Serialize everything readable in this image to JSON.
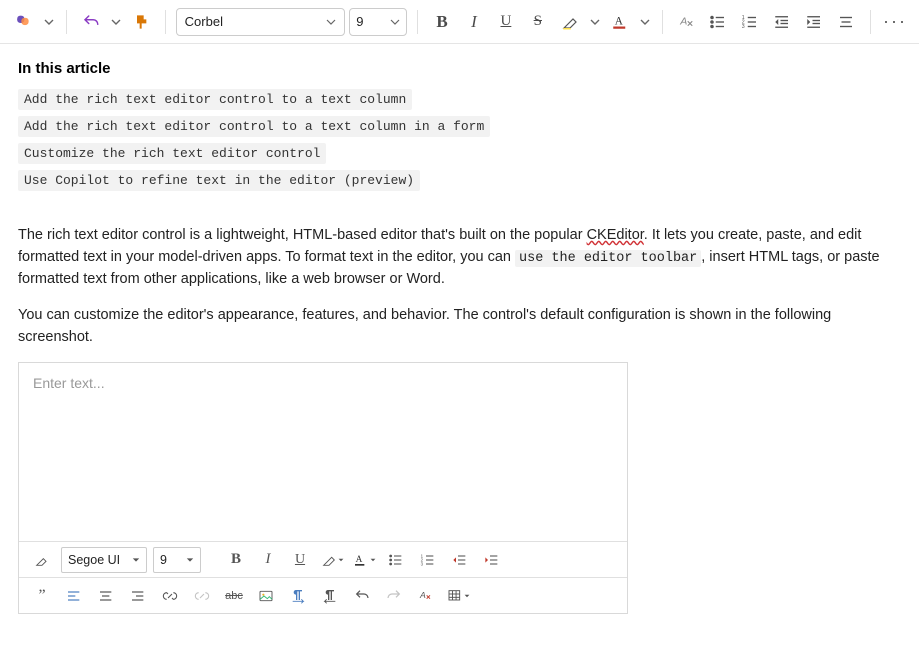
{
  "toolbar": {
    "font": "Corbel",
    "size": "9"
  },
  "article": {
    "header": "In this article",
    "toc": [
      "Add the rich text editor control to a text column",
      "Add the rich text editor control to a text column in a form",
      "Customize the rich text editor control",
      "Use Copilot to refine text in the editor (preview)"
    ],
    "para1_a": "The rich text editor control is a lightweight, HTML-based editor that's built on the popular ",
    "para1_squiggle": "CKEditor",
    "para1_b": ". It lets you create, paste, and edit formatted text in your model-driven apps. To format text in the editor, you can ",
    "para1_code": "use the editor toolbar",
    "para1_c": ", insert HTML tags, or paste formatted text from other applications, like a web browser or Word.",
    "para2": "You can customize the editor's appearance, features, and behavior. The control's default configuration is shown in the following screenshot."
  },
  "editorShot": {
    "placeholder": "Enter text...",
    "font": "Segoe UI",
    "size": "9"
  }
}
